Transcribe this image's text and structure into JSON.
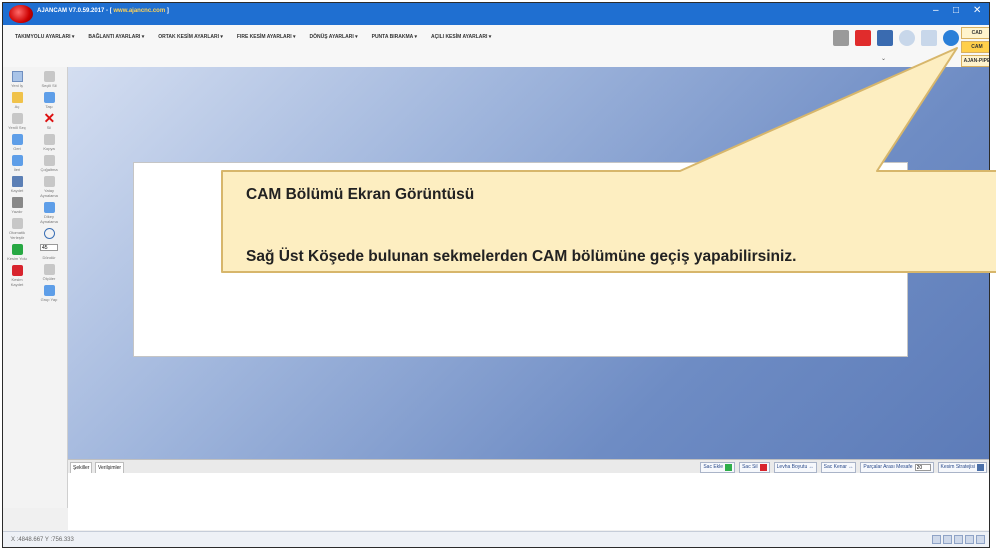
{
  "window": {
    "title": "AJANCAM V7.0.59.2017 - [ www.ajancnc.com ]",
    "title_prefix": "AJANCAM V7.0.59.2017 - [ ",
    "title_link": "www.ajancnc.com",
    "title_suffix": " ]",
    "minimize": "–",
    "maximize": "□",
    "close": "✕"
  },
  "menu": {
    "items": [
      "TAKIMYOLU AYARLARI ▾",
      "BAĞLANTI AYARLARI ▾",
      "ORTAK KESİM AYARLARI ▾",
      "FIRE KESİM AYARLARI ▾",
      "DÖNÜŞ AYARLARI ▾",
      "PUNTA BIRAKMA ▾",
      "AÇILI KESİM AYARLARI ▾"
    ],
    "chevron": "⌄"
  },
  "mode_tabs": {
    "cad": "CAD",
    "cam": "CAM",
    "pipe": "AJAN-PIPE"
  },
  "left_toolbar": {
    "col1": [
      {
        "label": "Yeni İş",
        "icon": "new-document-icon"
      },
      {
        "label": "Aç",
        "icon": "open-folder-icon"
      },
      {
        "label": "Yeniİl Seç",
        "icon": "select-icon"
      },
      {
        "label": "Geri",
        "icon": "undo-icon"
      },
      {
        "label": "İleri",
        "icon": "redo-icon"
      },
      {
        "label": "Kaydet",
        "icon": "save-icon"
      },
      {
        "label": "Yazdır",
        "icon": "print-icon"
      },
      {
        "label": "Otomatik Yerleştir",
        "icon": "auto-nest-icon"
      },
      {
        "label": "Kesim Yolu",
        "icon": "cut-path-icon"
      },
      {
        "label": "Kesim Kaydet",
        "icon": "cut-save-icon"
      }
    ],
    "col2": [
      {
        "label": "Seçili Sil",
        "icon": "select-delete-icon"
      },
      {
        "label": "Taşı",
        "icon": "move-icon"
      },
      {
        "label": "Sil",
        "icon": "delete-icon"
      },
      {
        "label": "Kopya",
        "icon": "copy-icon"
      },
      {
        "label": "Çoğaltma",
        "icon": "array-icon"
      },
      {
        "label": "Yatay Aynalama",
        "icon": "mirror-horizontal-icon"
      },
      {
        "label": "Dikey Aynalama",
        "icon": "mirror-vertical-icon"
      },
      {
        "label": "Döndür",
        "icon": "rotate-icon"
      },
      {
        "label": "Ölçüler",
        "icon": "measure-icon"
      },
      {
        "label": "Grup Yap",
        "icon": "group-icon"
      }
    ],
    "angle_value": "45"
  },
  "bottom_tabs": {
    "tab1": "Şekiller",
    "tab2": "Verilşimler"
  },
  "bottom_controls": {
    "sac_ekle": "Sac Ekle",
    "sac_sil": "Sac Sil",
    "levha_boyutu": "Levha Boyutu ↔",
    "sac_kenar": "Sac Kenar ↔",
    "parca_mesafe": "Parçalar Arası Mesafe",
    "parca_mesafe_value": "20",
    "kesim_stratejisi": "Kesim Stratejisi"
  },
  "status": {
    "coords": "X :4848.667 Y :756.333"
  },
  "callout": {
    "line1": "CAM Bölümü Ekran Görüntüsü",
    "line2": "Sağ Üst Köşede bulunan sekmelerden CAM bölümüne geçiş yapabilirsiniz."
  },
  "colors": {
    "titlebar": "#1f6fd1",
    "callout_fill": "#fdeec1",
    "callout_border": "#d7b66b",
    "active_tab": "#ffcf4a"
  }
}
